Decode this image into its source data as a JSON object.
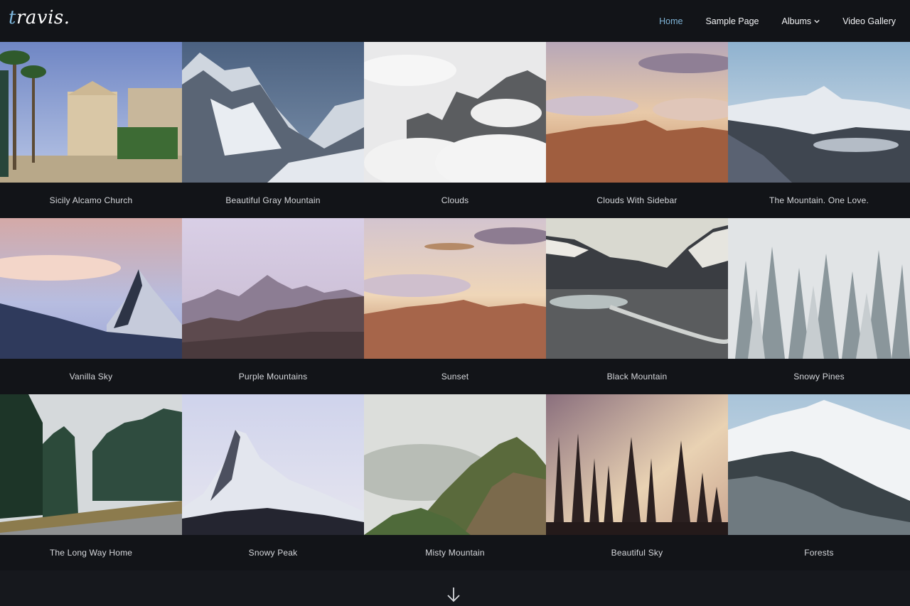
{
  "site": {
    "logo": "travis.",
    "logo_first": "t",
    "logo_rest": "ravis."
  },
  "nav": {
    "items": [
      {
        "label": "Home",
        "active": true
      },
      {
        "label": "Sample Page"
      },
      {
        "label": "Albums",
        "has_dropdown": true,
        "icon": "chevron-down-icon"
      },
      {
        "label": "Video Gallery"
      }
    ]
  },
  "gallery": {
    "items": [
      {
        "title": "Sicily Alcamo Church"
      },
      {
        "title": "Beautiful Gray Mountain"
      },
      {
        "title": "Clouds"
      },
      {
        "title": "Clouds With Sidebar"
      },
      {
        "title": "The Mountain. One Love."
      },
      {
        "title": "Vanilla Sky"
      },
      {
        "title": "Purple Mountains"
      },
      {
        "title": "Sunset"
      },
      {
        "title": "Black Mountain"
      },
      {
        "title": "Snowy Pines"
      },
      {
        "title": "The Long Way Home"
      },
      {
        "title": "Snowy Peak"
      },
      {
        "title": "Misty Mountain"
      },
      {
        "title": "Beautiful Sky"
      },
      {
        "title": "Forests"
      }
    ]
  },
  "footer": {
    "scroll_icon": "arrow-down-icon"
  },
  "colors": {
    "background": "#16181d",
    "header": "#121418",
    "accent": "#7fb3d6"
  }
}
